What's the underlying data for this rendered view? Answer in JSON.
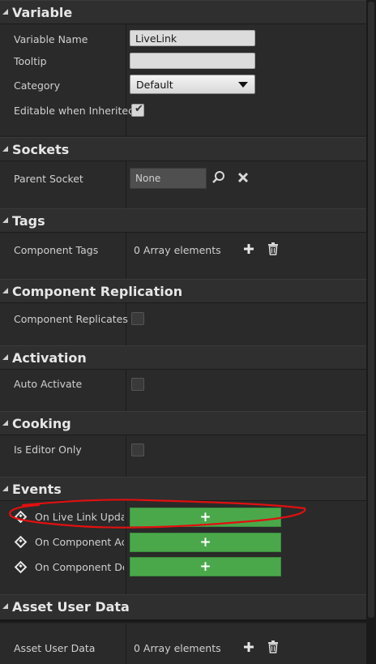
{
  "categories": {
    "variable": "Variable",
    "sockets": "Sockets",
    "tags": "Tags",
    "replication": "Component Replication",
    "activation": "Activation",
    "cooking": "Cooking",
    "events": "Events",
    "asset_user_data": "Asset User Data"
  },
  "variable": {
    "name_label": "Variable Name",
    "name_value": "LiveLink",
    "tooltip_label": "Tooltip",
    "tooltip_value": "",
    "category_label": "Category",
    "category_value": "Default",
    "editable_label": "Editable when Inherited",
    "editable_checked": true
  },
  "sockets": {
    "parent_label": "Parent Socket",
    "parent_value": "None"
  },
  "tags": {
    "label": "Component Tags",
    "value": "0 Array elements"
  },
  "replication": {
    "label": "Component Replicates",
    "checked": false
  },
  "activation": {
    "label": "Auto Activate",
    "checked": false
  },
  "cooking": {
    "label": "Is Editor Only",
    "checked": false
  },
  "events": {
    "items": [
      {
        "label": "On Live Link Update"
      },
      {
        "label": "On Component Acti"
      },
      {
        "label": "On Component Dea"
      }
    ],
    "add_glyph": "+"
  },
  "asset_user_data": {
    "label": "Asset User Data",
    "value": "0 Array elements"
  },
  "colors": {
    "event_button": "#4aa84b",
    "annotation": "#e01010"
  },
  "icons": {
    "browse": "search-icon",
    "clear": "close-icon",
    "add": "plus-icon",
    "delete": "trash-icon"
  }
}
